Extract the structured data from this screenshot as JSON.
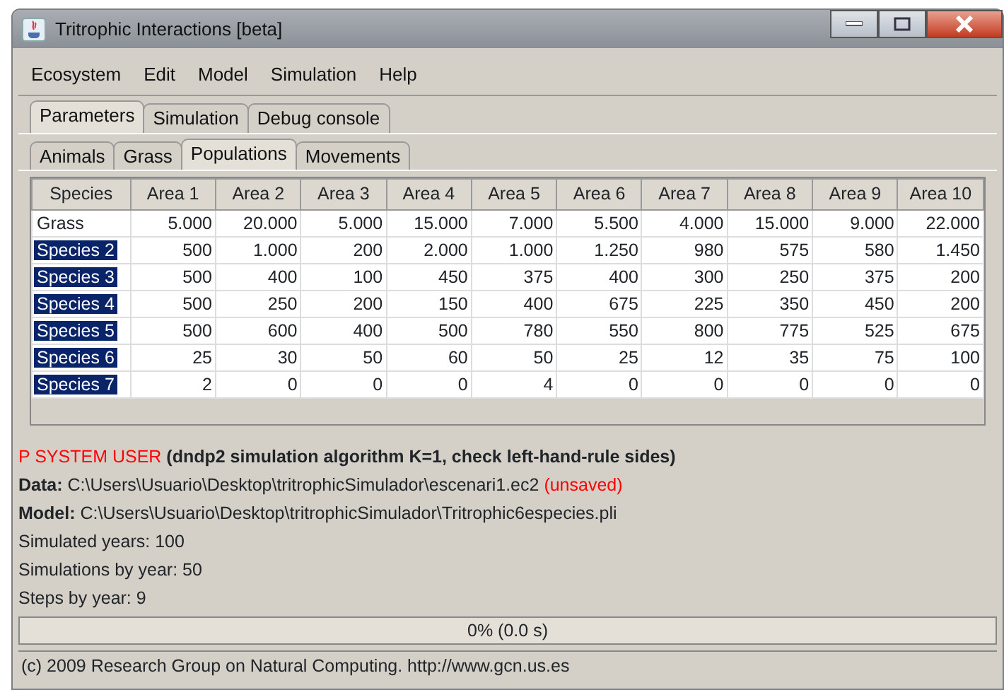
{
  "window": {
    "title": "Tritrophic Interactions [beta]"
  },
  "menu": [
    "Ecosystem",
    "Edit",
    "Model",
    "Simulation",
    "Help"
  ],
  "tabs": [
    {
      "label": "Parameters",
      "selected": true
    },
    {
      "label": "Simulation",
      "selected": false
    },
    {
      "label": "Debug console",
      "selected": false
    }
  ],
  "subtabs": [
    {
      "label": "Animals",
      "selected": false
    },
    {
      "label": "Grass",
      "selected": false
    },
    {
      "label": "Populations",
      "selected": true
    },
    {
      "label": "Movements",
      "selected": false
    }
  ],
  "table": {
    "columns": [
      "Species",
      "Area 1",
      "Area 2",
      "Area 3",
      "Area 4",
      "Area 5",
      "Area 6",
      "Area 7",
      "Area 8",
      "Area 9",
      "Area 10"
    ],
    "rows": [
      {
        "selected": false,
        "cells": [
          "Grass",
          "5.000",
          "20.000",
          "5.000",
          "15.000",
          "7.000",
          "5.500",
          "4.000",
          "15.000",
          "9.000",
          "22.000"
        ]
      },
      {
        "selected": true,
        "cells": [
          "Species 2",
          "500",
          "1.000",
          "200",
          "2.000",
          "1.000",
          "1.250",
          "980",
          "575",
          "580",
          "1.450"
        ]
      },
      {
        "selected": true,
        "cells": [
          "Species 3",
          "500",
          "400",
          "100",
          "450",
          "375",
          "400",
          "300",
          "250",
          "375",
          "200"
        ]
      },
      {
        "selected": true,
        "cells": [
          "Species 4",
          "500",
          "250",
          "200",
          "150",
          "400",
          "675",
          "225",
          "350",
          "450",
          "200"
        ]
      },
      {
        "selected": true,
        "cells": [
          "Species 5",
          "500",
          "600",
          "400",
          "500",
          "780",
          "550",
          "800",
          "775",
          "525",
          "675"
        ]
      },
      {
        "selected": true,
        "cells": [
          "Species 6",
          "25",
          "30",
          "50",
          "60",
          "50",
          "25",
          "12",
          "35",
          "75",
          "100"
        ]
      },
      {
        "selected": true,
        "cells": [
          "Species 7",
          "2",
          "0",
          "0",
          "0",
          "4",
          "0",
          "0",
          "0",
          "0",
          "0"
        ]
      }
    ]
  },
  "info": [
    [
      {
        "kind": "alert",
        "text": "P SYSTEM USER"
      },
      {
        "kind": "label",
        "text": " (dndp2 simulation algorithm K=1, check left-hand-rule sides)"
      }
    ],
    [
      {
        "kind": "label",
        "text": "Data:"
      },
      {
        "kind": "text",
        "text": " C:\\Users\\Usuario\\Desktop\\tritrophicSimulador\\escenari1.ec2 "
      },
      {
        "kind": "alert",
        "text": "(unsaved)"
      }
    ],
    [
      {
        "kind": "label",
        "text": "Model:"
      },
      {
        "kind": "text",
        "text": " C:\\Users\\Usuario\\Desktop\\tritrophicSimulador\\Tritrophic6especies.pli"
      }
    ],
    [
      {
        "kind": "text",
        "text": "Simulated years: 100"
      }
    ],
    [
      {
        "kind": "text",
        "text": "Simulations by year: 50"
      }
    ],
    [
      {
        "kind": "text",
        "text": "Steps by year: 9"
      }
    ]
  ],
  "progress": {
    "level": 0,
    "reading": "0% (0.0 s)"
  },
  "status_bar": "(c) 2009 Research Group on Natural Computing. http://www.gcn.us.es"
}
